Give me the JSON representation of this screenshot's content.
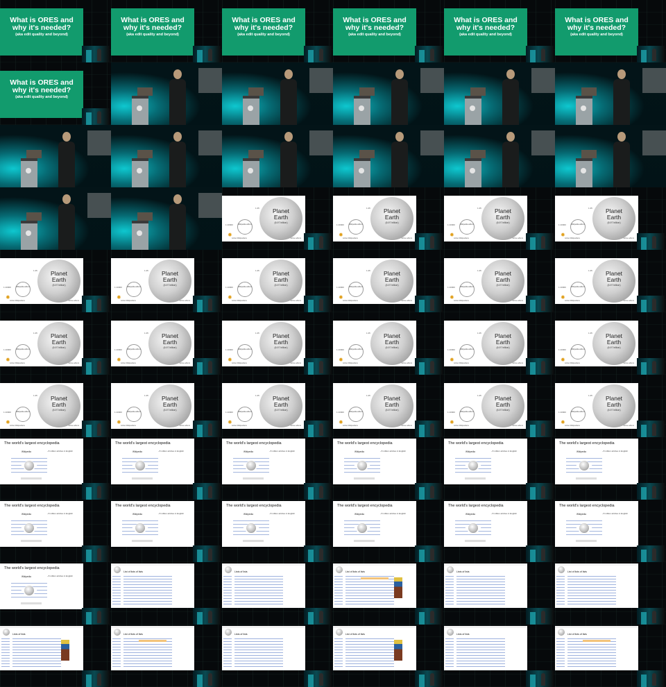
{
  "slides": {
    "title": {
      "line1": "What is ORES and",
      "line2": "why it's needed?",
      "subtitle": "(aka edit quality and beyond)",
      "color": "#129b6d"
    },
    "earth": {
      "title_line1": "Planet",
      "title_line2": "Earth",
      "sub": "(6.97 billion)",
      "scale_left": "1:10000",
      "scale_top": "1:45",
      "small_circle": "Wikipedia editors",
      "foot_left": "Active Wikipedians",
      "foot_right": "active editors"
    },
    "encyclopedia": {
      "title": "The world's largest encyclopedia",
      "caption": "~5 million articles in English",
      "logo": "Wikipedia"
    },
    "web": {
      "list_title": "List of lists of lists",
      "article_title": "Lists of lists"
    }
  },
  "grid": {
    "columns": 6,
    "rows": 11,
    "cells": [
      "title",
      "title",
      "title",
      "title",
      "title",
      "title",
      "title",
      "stage",
      "stage",
      "stage",
      "stage",
      "stage",
      "stage",
      "stage",
      "stage",
      "stage",
      "stage",
      "stage",
      "stage",
      "stage",
      "earth",
      "earth",
      "earth",
      "earth",
      "earth",
      "earth",
      "earth",
      "earth",
      "earth",
      "earth",
      "earth",
      "earth",
      "earth",
      "earth",
      "earth",
      "earth",
      "earth",
      "earth",
      "earth",
      "earth",
      "earth",
      "earth",
      "enc",
      "enc",
      "enc",
      "enc",
      "enc",
      "enc",
      "enc",
      "enc",
      "enc",
      "enc",
      "enc",
      "enc",
      "enc",
      "web",
      "web",
      "web",
      "web",
      "web",
      "web",
      "web",
      "web",
      "web",
      "web",
      "web"
    ]
  }
}
